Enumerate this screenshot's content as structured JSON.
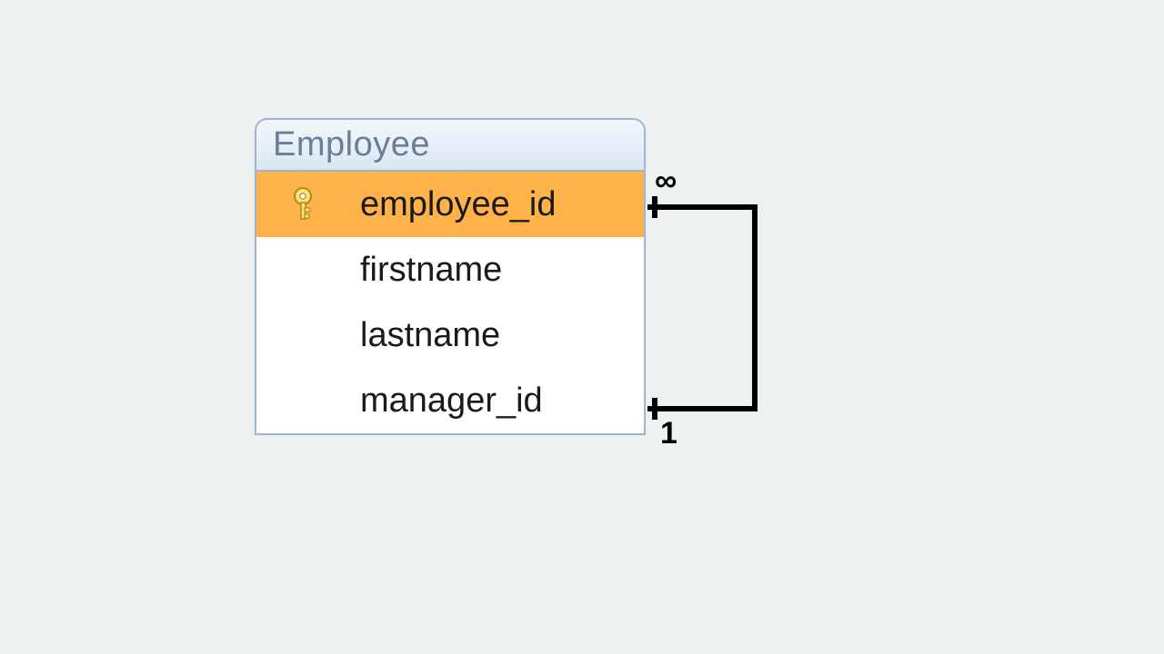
{
  "entity": {
    "name": "Employee",
    "fields": [
      {
        "name": "employee_id",
        "pk": true
      },
      {
        "name": "firstname",
        "pk": false
      },
      {
        "name": "lastname",
        "pk": false
      },
      {
        "name": "manager_id",
        "pk": false
      }
    ]
  },
  "relationship": {
    "from_field": "manager_id",
    "to_field": "employee_id",
    "from_cardinality": "1",
    "to_cardinality": "∞"
  }
}
